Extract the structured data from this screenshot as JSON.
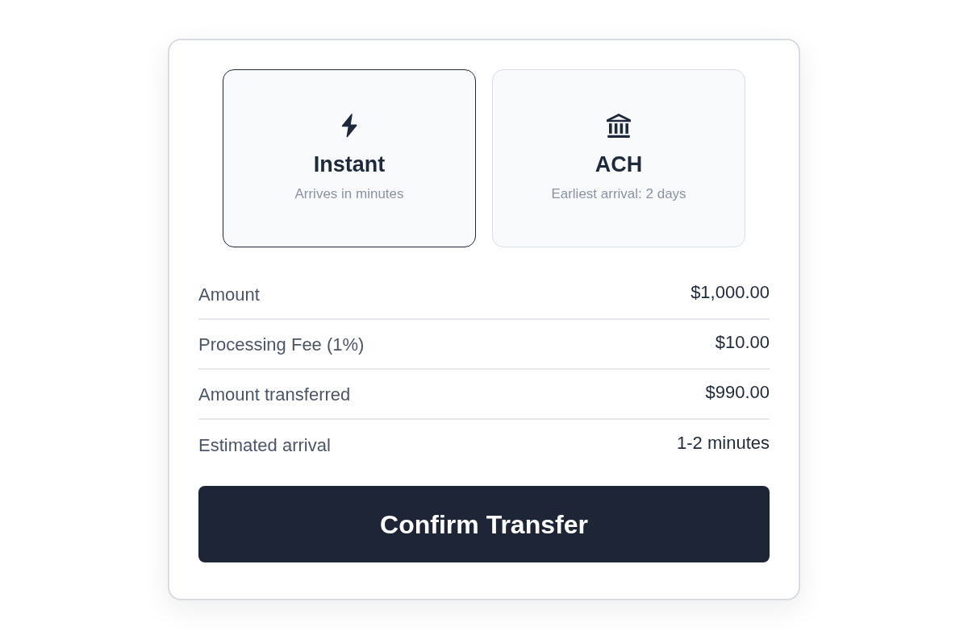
{
  "methods": [
    {
      "kind": "instant",
      "title": "Instant",
      "subtitle": "Arrives in minutes",
      "selected": true
    },
    {
      "kind": "bank",
      "title": "ACH",
      "subtitle": "Earliest arrival: 2 days",
      "selected": false
    }
  ],
  "summary": [
    {
      "label": "Amount",
      "value": "$1,000.00"
    },
    {
      "label": "Processing Fee (1%)",
      "value": "$10.00"
    },
    {
      "label": "Amount transferred",
      "value": "$990.00"
    },
    {
      "label": "Estimated arrival",
      "value": "1-2 minutes"
    }
  ],
  "confirm_button": {
    "label": "Confirm Transfer"
  }
}
